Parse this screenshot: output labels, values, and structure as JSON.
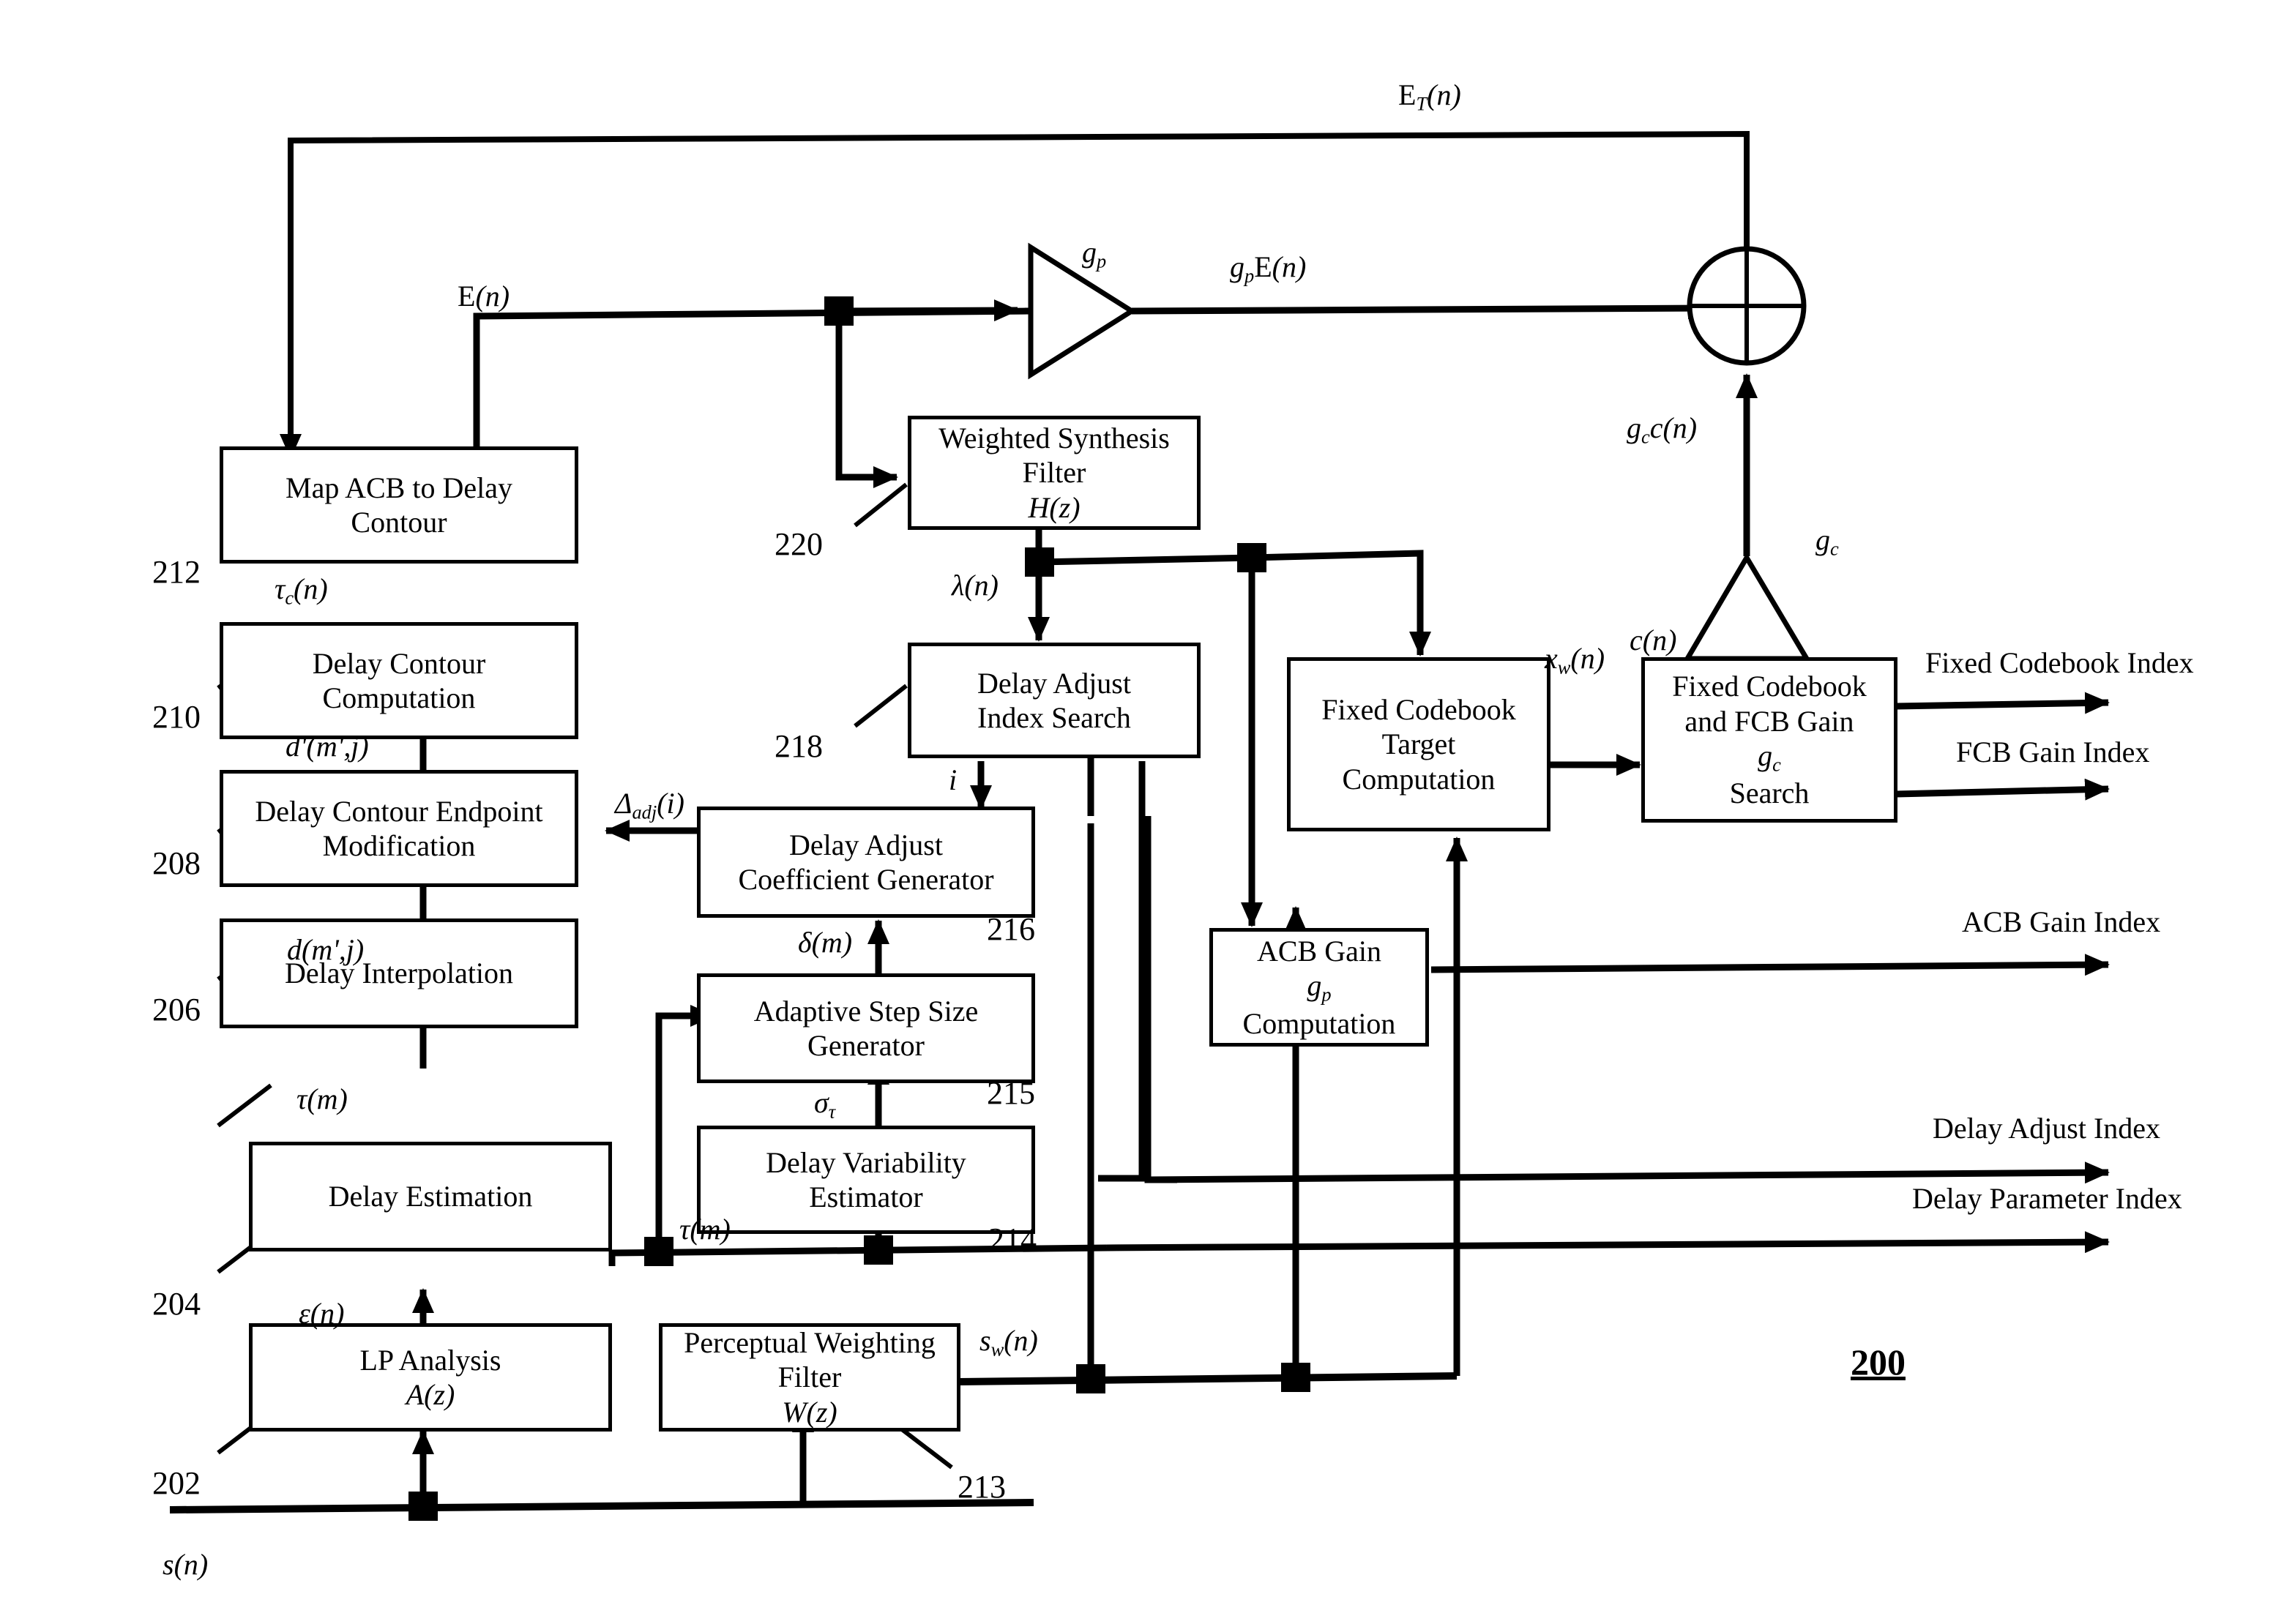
{
  "figure": {
    "number": "200"
  },
  "blocks": [
    {
      "id": "212",
      "ref": "212",
      "lines": [
        "Map ACB to Delay",
        "Contour"
      ]
    },
    {
      "id": "210",
      "ref": "210",
      "lines": [
        "Delay Contour",
        "Computation"
      ]
    },
    {
      "id": "208",
      "ref": "208",
      "lines": [
        "Delay Contour Endpoint",
        "Modification"
      ]
    },
    {
      "id": "206",
      "ref": "206",
      "lines": [
        "Delay Interpolation"
      ]
    },
    {
      "id": "204",
      "ref": "204",
      "lines": [
        "Delay Estimation"
      ]
    },
    {
      "id": "202",
      "ref": "202",
      "lines": [
        "LP Analysis A(z)"
      ]
    },
    {
      "id": "213",
      "ref": "213",
      "lines": [
        "Perceptual Weighting",
        "Filter W(z)"
      ]
    },
    {
      "id": "214",
      "ref": "214",
      "lines": [
        "Delay Variability",
        "Estimator"
      ]
    },
    {
      "id": "215",
      "ref": "215",
      "lines": [
        "Adaptive Step Size",
        "Generator"
      ]
    },
    {
      "id": "216",
      "ref": "216",
      "lines": [
        "Delay Adjust",
        "Coefficient Generator"
      ]
    },
    {
      "id": "218",
      "ref": "218",
      "lines": [
        "Delay Adjust",
        "Index Search"
      ]
    },
    {
      "id": "220",
      "ref": "220",
      "lines": [
        "Weighted Synthesis",
        "Filter H(z)"
      ]
    },
    {
      "id": "fcbtarget",
      "ref": "",
      "lines": [
        "Fixed Codebook",
        "Target",
        "Computation"
      ]
    },
    {
      "id": "acbgain",
      "ref": "",
      "lines": [
        "ACB Gain g",
        "Computation"
      ]
    },
    {
      "id": "fcbsearch",
      "ref": "",
      "lines": [
        "Fixed Codebook",
        "and FCB Gain g",
        "Search"
      ]
    }
  ],
  "signals": {
    "e_t_n": "E",
    "e_n": "E(n)",
    "gp": "g",
    "gp_e_n": "g",
    "gc": "g",
    "gc_c_n": "g",
    "c_n": "c(n)",
    "lambda_n": "λ(n)",
    "tau_c_n": "τ",
    "d_prime_mj": "d'(m',j)",
    "d_mj": "d(m',j)",
    "tau_m": "τ(m)",
    "tau_m_2": "τ(m)",
    "epsilon_n": "ε(n)",
    "delta_adj_i": "Δ",
    "delta_m": "δ(m)",
    "sigma_tau": "σ",
    "i": "i",
    "x_w_n": "x",
    "s_w_n": "s",
    "s_n": "s(n)"
  },
  "signal_text": {
    "e_t_n": "E_T(n)",
    "e_n": "E(n)",
    "gp": "g_p",
    "gp_e_n": "g_pE(n)",
    "gc": "g_c",
    "gc_c_n": "g_c c(n)",
    "c_n": "c(n)",
    "lambda_n": "lambda(n)",
    "tau_c_n": "tau_c(n)",
    "d_prime_mj": "d'(m',j)",
    "d_mj": "d(m',j)",
    "tau_m": "tau(m)",
    "epsilon_n": "epsilon(n)",
    "delta_adj_i": "Delta_adj(i)",
    "delta_m": "delta(m)",
    "sigma_tau": "sigma_tau",
    "i": "i",
    "x_w_n": "x_w(n)",
    "s_w_n": "s_w(n)",
    "s_n": "s(n)"
  },
  "outputs": [
    {
      "id": "fixed-codebook-index",
      "label": "Fixed Codebook Index"
    },
    {
      "id": "fcb-gain-index",
      "label": "FCB Gain Index"
    },
    {
      "id": "acb-gain-index",
      "label": "ACB Gain Index"
    },
    {
      "id": "delay-adjust-index",
      "label": "Delay Adjust Index"
    },
    {
      "id": "delay-parameter-index",
      "label": "Delay Parameter Index"
    }
  ],
  "block_refs": {
    "b212": "212",
    "b210": "210",
    "b208": "208",
    "b206": "206",
    "b204": "204",
    "b202": "202",
    "b213": "213",
    "b214": "214",
    "b215": "215",
    "b216": "216",
    "b218": "218",
    "b220": "220"
  },
  "block_text": {
    "b212_l1": "Map ACB to Delay",
    "b212_l2": "Contour",
    "b210_l1": "Delay Contour",
    "b210_l2": "Computation",
    "b208_l1": "Delay Contour Endpoint",
    "b208_l2": "Modification",
    "b206_l1": "Delay Interpolation",
    "b204_l1": "Delay Estimation",
    "b202_l1": "LP Analysis ",
    "b202_l2": "A(z)",
    "b213_l1": "Perceptual Weighting",
    "b213_l2": "Filter ",
    "b213_l3": "W(z)",
    "b214_l1": "Delay Variability",
    "b214_l2": "Estimator",
    "b215_l1": "Adaptive Step Size",
    "b215_l2": "Generator",
    "b216_l1": "Delay Adjust",
    "b216_l2": "Coefficient Generator",
    "b218_l1": "Delay Adjust",
    "b218_l2": "Index Search",
    "b220_l1": "Weighted Synthesis",
    "b220_l2": "Filter ",
    "b220_l3": "H(z)",
    "fcbt_l1": "Fixed Codebook",
    "fcbt_l2": "Target",
    "fcbt_l3": "Computation",
    "acbg_l1": "ACB Gain ",
    "acbg_l1b": "g",
    "acbg_l1c": "p",
    "acbg_l2": "Computation",
    "fcbs_l1": "Fixed Codebook",
    "fcbs_l2": "and FCB Gain ",
    "fcbs_l2b": "g",
    "fcbs_l2c": "c",
    "fcbs_l3": "Search"
  },
  "colors": {
    "ink": "#000000",
    "paper": "#ffffff"
  }
}
